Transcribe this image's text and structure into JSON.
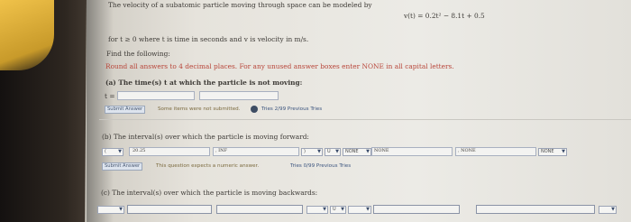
{
  "problem": {
    "intro": "The velocity of a subatomic particle moving through space can be modeled by",
    "equation": "v(t) = 0.2t² − 8.1t + 0.5",
    "condition": "for t ≥ 0 where t is time in seconds and v is velocity in m/s.",
    "find": "Find the following:",
    "instruction": "Round all answers to 4 decimal places. For any unused answer boxes enter NONE in all capital letters."
  },
  "part_a": {
    "label": "(a) The time(s) t at which the particle is not moving:",
    "prefix": "t =",
    "submit": "Submit Answer",
    "status": "Some items were not submitted.",
    "tries": "Tries 2/99 Previous Tries"
  },
  "part_b": {
    "label": "(b) The interval(s) over which the particle is moving forward:",
    "open_bracket": "(",
    "first_value": "20.25",
    "second_value": ", INF",
    "close_bracket": ")",
    "union_select": "U",
    "none_select_1": "NONE",
    "none_field_1": "NONE",
    "none_field_2": ", NONE",
    "none_select_2": "NONE",
    "submit": "Submit Answer",
    "status": "This question expects a numeric answer.",
    "tries": "Tries 0/99 Previous Tries"
  },
  "part_c": {
    "label": "(c) The interval(s) over which the particle is moving backwards:",
    "union_select": "U"
  },
  "colors": {
    "accent_red": "#b8463a",
    "button_blue": "#dde4ee"
  }
}
